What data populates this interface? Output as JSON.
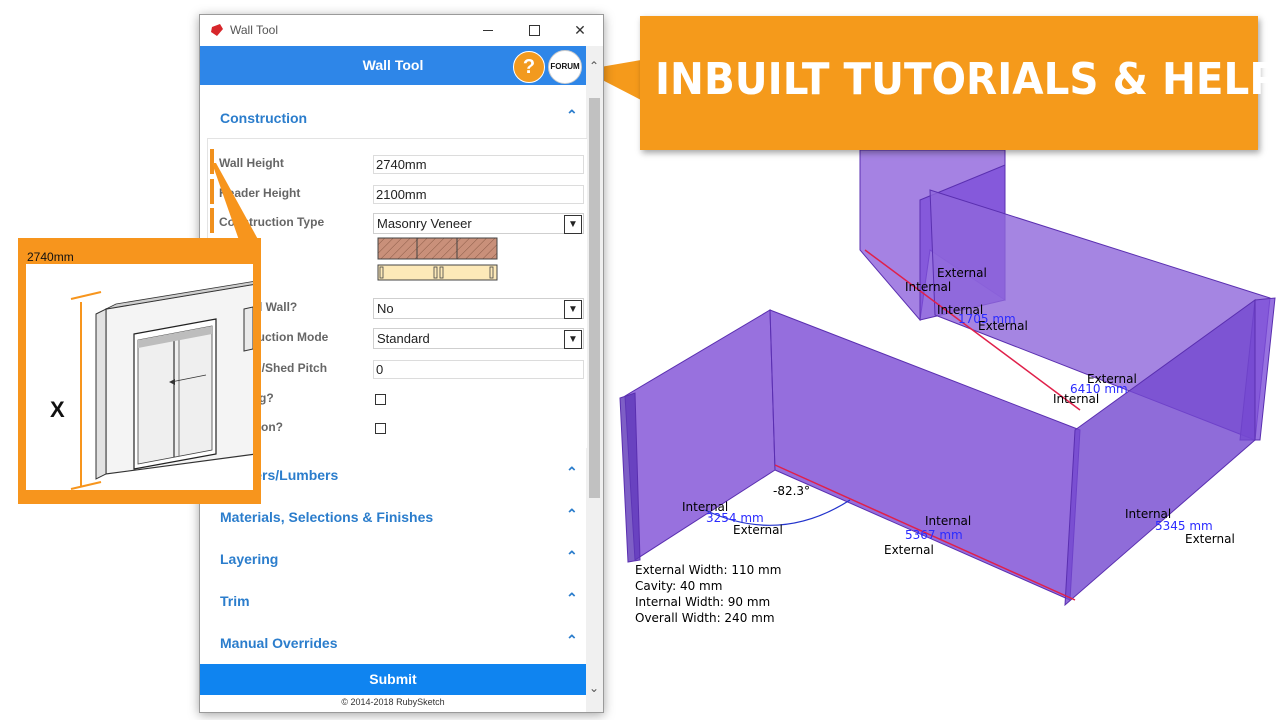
{
  "window": {
    "title": "Wall Tool",
    "header_title": "Wall Tool",
    "help_label": "?",
    "forum_label": "FORUM"
  },
  "sections": {
    "construction": "Construction",
    "framing": "Framers/Lumbers",
    "materials": "Materials, Selections & Finishes",
    "layering": "Layering",
    "trim": "Trim",
    "overrides": "Manual Overrides"
  },
  "fields": {
    "wall_height_label": "Wall Height",
    "wall_height_value": "2740mm",
    "header_height_label": "Header Height",
    "header_height_value": "2100mm",
    "construction_type_label": "Construction Type",
    "construction_type_value": "Masonry Veneer",
    "internal_wall_label": "Internal Wall?",
    "internal_wall_value": "No",
    "construction_mode_label": "Construction Mode",
    "construction_mode_value": "Standard",
    "skillion_label": "Skillion/Shed Pitch",
    "skillion_value": "0",
    "check1_label": "Framing?",
    "check2_label": "Insulation?"
  },
  "submit_label": "Submit",
  "footer": "© 2014-2018 RubySketch",
  "banner": "INBUILT TUTORIALS & HELP",
  "inset": {
    "dimension": "2740mm",
    "axis_label": "X"
  },
  "viewport": {
    "labels": {
      "ext1": "External",
      "int1": "Internal",
      "int2": "Internal",
      "ext2": "External",
      "dim2": "1705 mm",
      "ext3": "External",
      "int3": "Internal",
      "dim3": "6410 mm",
      "int4": "Internal",
      "dim4": "3254 mm",
      "ext4": "External",
      "angle": "-82.3°",
      "int5": "Internal",
      "dim5": "5367 mm",
      "ext5": "External",
      "int6": "Internal",
      "dim6": "5345 mm",
      "ext6": "External"
    },
    "info": {
      "line1": "External Width: 110 mm",
      "line2": "Cavity: 40 mm",
      "line3": "Internal Width: 90 mm",
      "line4": "Overall Width: 240 mm"
    }
  },
  "colors": {
    "accent_blue": "#2e86e8",
    "orange": "#f59a1b",
    "wall_purple": "#8a5ad6"
  }
}
